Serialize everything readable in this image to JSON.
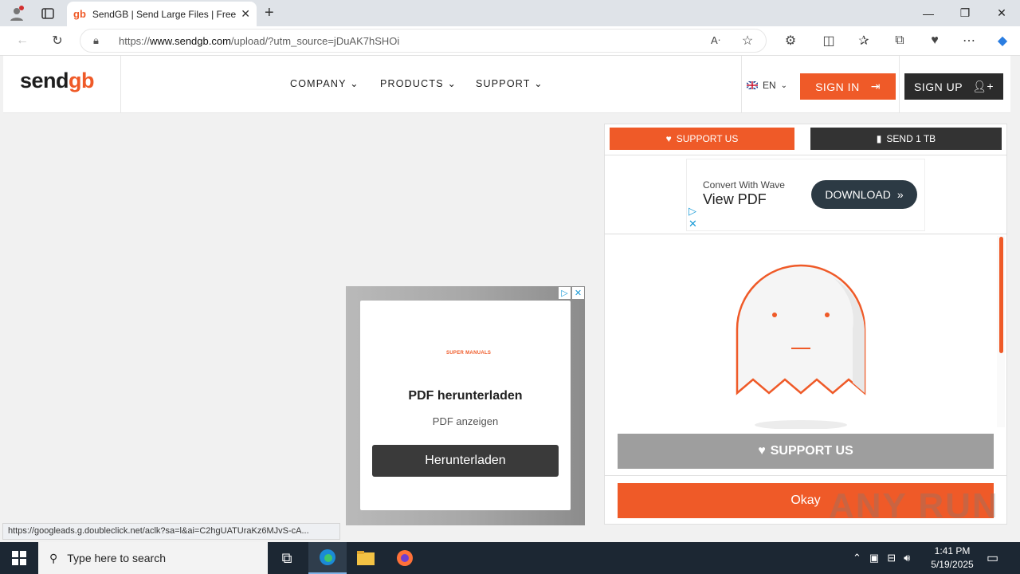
{
  "browser": {
    "tab_title": "SendGB | Send Large Files | Free f",
    "url_prefix": "https://",
    "url_host": "www.sendgb.com",
    "url_path": "/upload/?utm_source=jDuAK7hSHOi",
    "status_link": "https://googleads.g.doubleclick.net/aclk?sa=l&ai=C2hgUATUraKz6MJvS-cA..."
  },
  "site": {
    "logo_text": "send",
    "logo_accent": "gb",
    "nav": [
      "COMPANY",
      "PRODUCTS",
      "SUPPORT"
    ],
    "lang": "EN",
    "sign_in": "SIGN IN",
    "sign_up": "SIGN UP"
  },
  "panel": {
    "support_us": "SUPPORT US",
    "send_1tb": "SEND 1 TB",
    "support_us_big": "SUPPORT US",
    "okay": "Okay"
  },
  "top_ad": {
    "subtitle": "Convert With Wave",
    "title": "View PDF",
    "button": "DOWNLOAD"
  },
  "mid_ad": {
    "logo": "SUPER MANUALS",
    "title": "PDF herunterladen",
    "subtitle": "PDF anzeigen",
    "button": "Herunterladen"
  },
  "taskbar": {
    "search_placeholder": "Type here to search",
    "time": "1:41 PM",
    "date": "5/19/2025"
  },
  "watermark": "ANY RUN",
  "colors": {
    "brand_orange": "#ef5a28",
    "dark": "#2b2b2b",
    "taskbar": "#1c2733"
  }
}
